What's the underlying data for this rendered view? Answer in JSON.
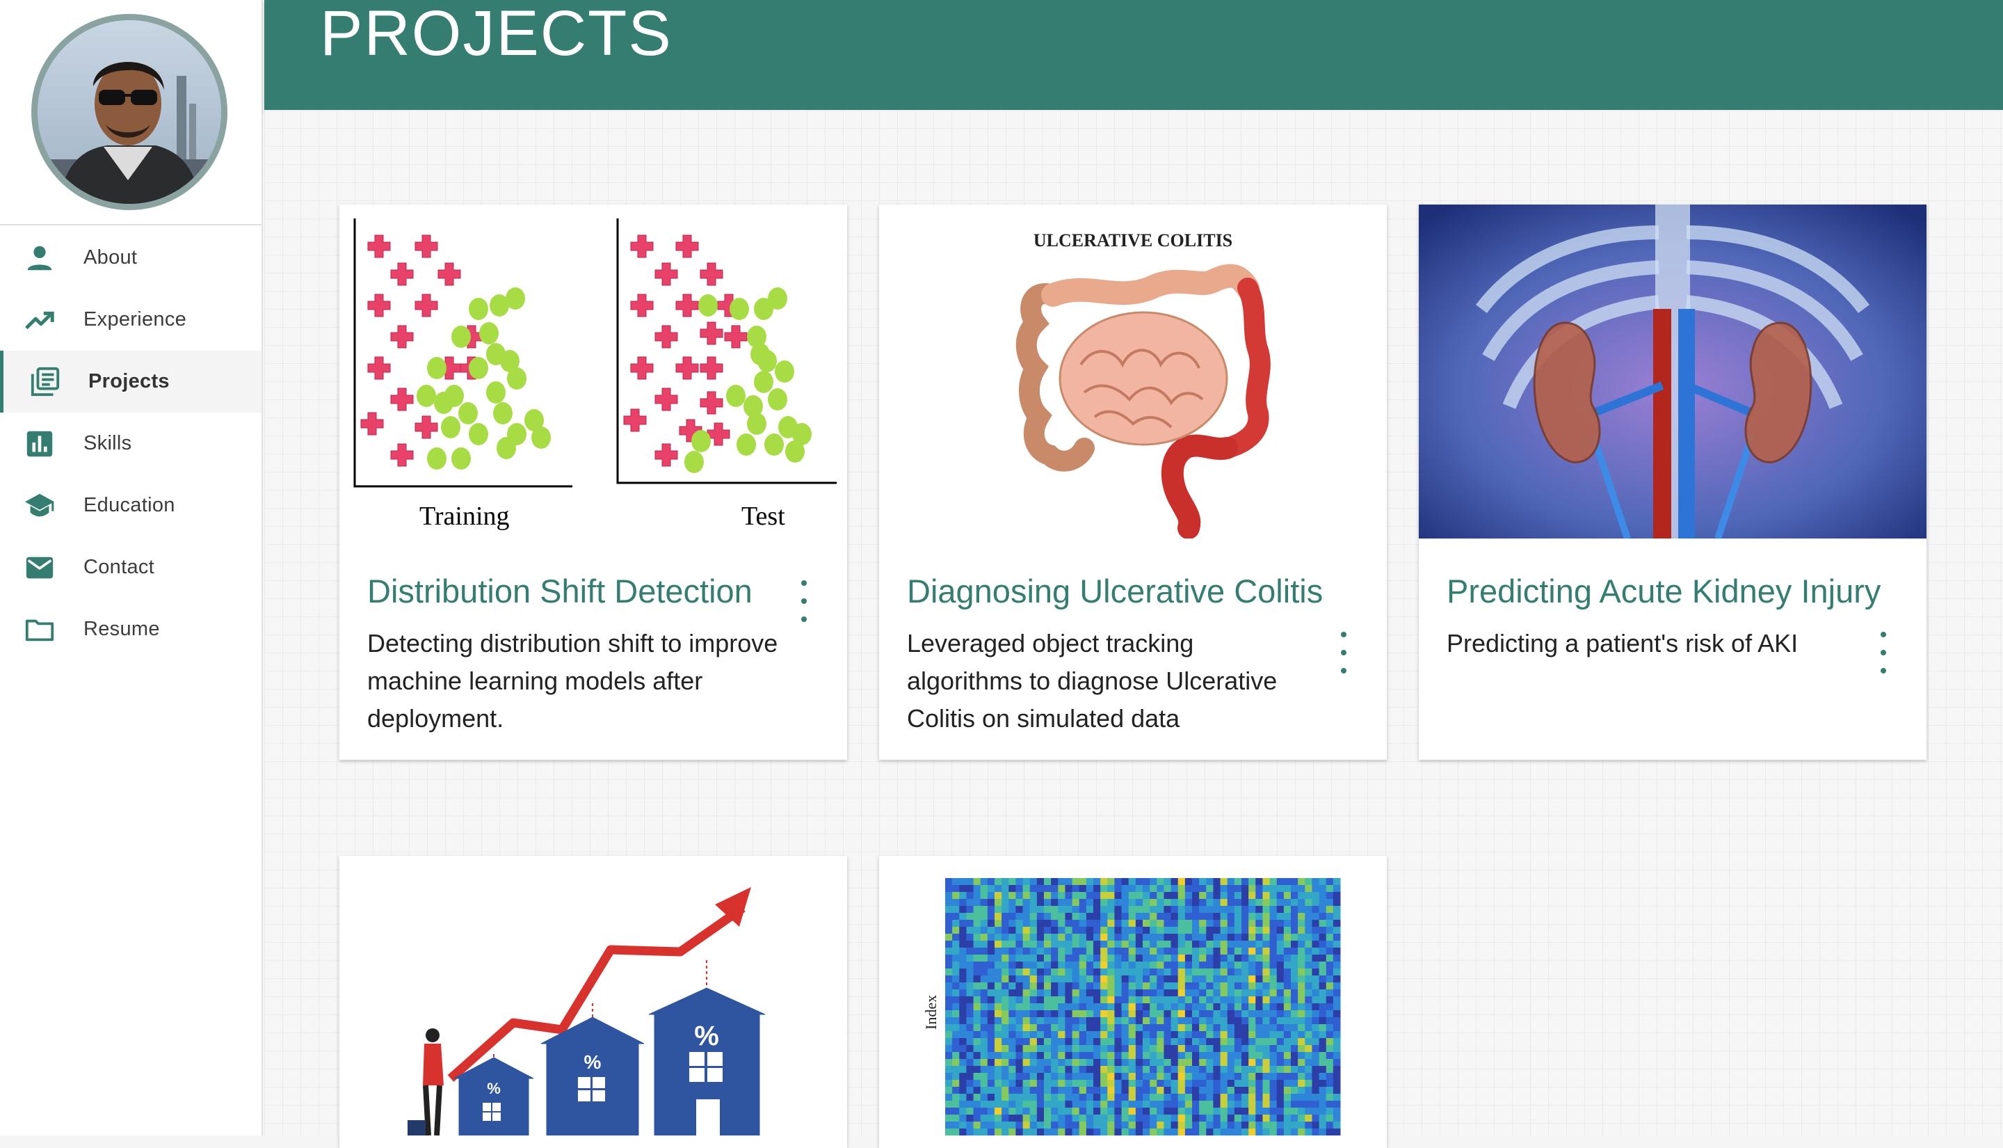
{
  "header": {
    "title": "PROJECTS"
  },
  "sidebar": {
    "items": [
      {
        "label": "About",
        "icon": "person-icon"
      },
      {
        "label": "Experience",
        "icon": "trending-up-icon"
      },
      {
        "label": "Projects",
        "icon": "article-icon",
        "active": true
      },
      {
        "label": "Skills",
        "icon": "bar-chart-icon"
      },
      {
        "label": "Education",
        "icon": "school-icon"
      },
      {
        "label": "Contact",
        "icon": "mail-icon"
      },
      {
        "label": "Resume",
        "icon": "folder-icon"
      }
    ]
  },
  "projects": [
    {
      "title": "Distribution Shift Detection",
      "description": "Detecting distribution shift to improve machine learning models after deployment.",
      "image": {
        "left_label": "Training",
        "right_label": "Test"
      }
    },
    {
      "title": "Diagnosing Ulcerative Colitis",
      "description": "Leveraged object tracking algorithms to diagnose Ulcerative Colitis on simulated data",
      "image": {
        "label": "ULCERATIVE COLITIS"
      }
    },
    {
      "title": "Predicting Acute Kidney Injury",
      "description": "Predicting a patient's risk of AKI"
    },
    {
      "image": {
        "badge": "%"
      }
    },
    {
      "image": {
        "ylabel": "Index"
      }
    }
  ],
  "colors": {
    "accent": "#367d71",
    "header_bg": "#367d71",
    "cross": "#e8416a",
    "dot": "#a8dc45"
  }
}
